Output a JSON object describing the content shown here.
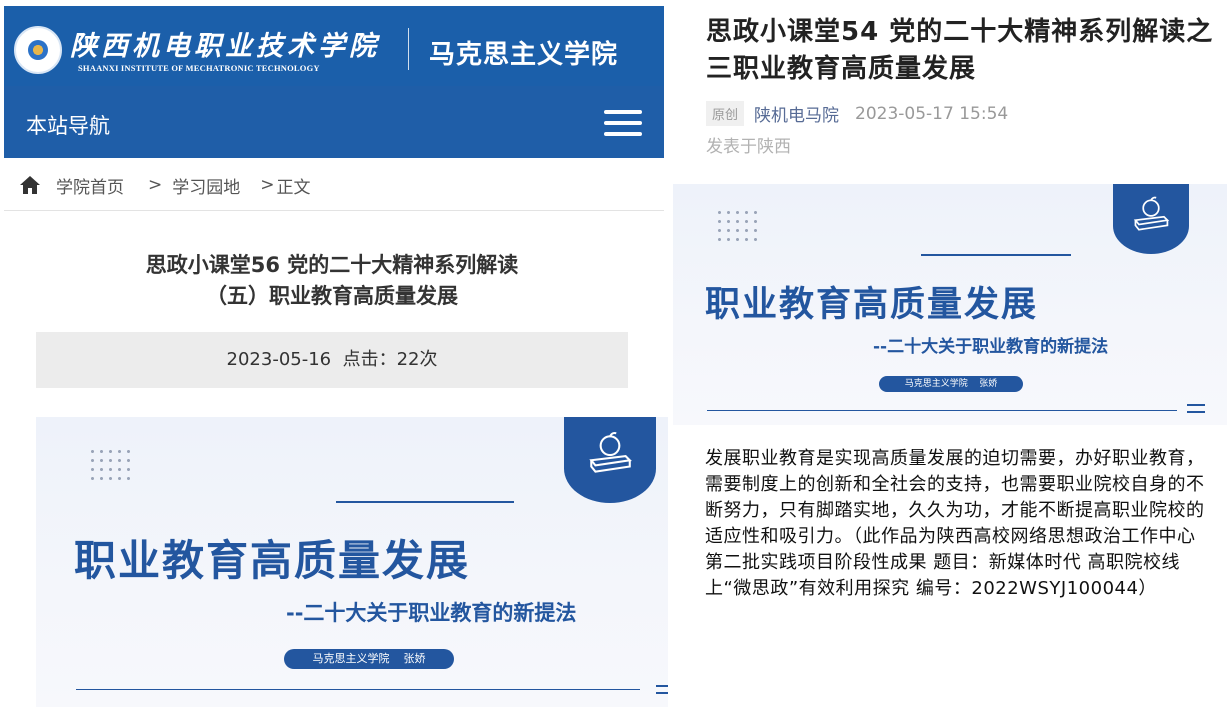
{
  "left": {
    "school_name_cn": "陕西机电职业技术学院",
    "school_name_en": "SHAANXI INSTITUTE OF MECHATRONIC TECHNOLOGY",
    "college_name": "马克思主义学院",
    "nav_label": "本站导航",
    "breadcrumb": {
      "home": "学院首页",
      "sep1": ">",
      "section": "学习园地",
      "sep2": ">",
      "current": "正文"
    },
    "article_title_line1": "思政小课堂56 党的二十大精神系列解读",
    "article_title_line2": "（五）职业教育高质量发展",
    "meta": "2023-05-16  点击：22次",
    "banner": {
      "headline": "职业教育高质量发展",
      "subheadline": "--二十大关于职业教育的新提法",
      "presenter": "马克思主义学院    张娇"
    }
  },
  "right": {
    "title": "思政小课堂54 党的二十大精神系列解读之三职业教育高质量发展",
    "tag": "原创",
    "author": "陕机电马院",
    "datetime": "2023-05-17 15:54",
    "location": "发表于陕西",
    "banner": {
      "headline": "职业教育高质量发展",
      "subheadline": "--二十大关于职业教育的新提法",
      "presenter": "马克思主义学院    张娇"
    },
    "body": "发展职业教育是实现高质量发展的迫切需要，办好职业教育，需要制度上的创新和全社会的支持，也需要职业院校自身的不断努力，只有脚踏实地，久久为功，才能不断提高职业院校的适应性和吸引力。（此作品为陕西高校网络思想政治工作中心第二批实践项目阶段性成果 题目：新媒体时代 高职院校线上“微思政”有效利用探究  编号：2022WSYJ100044）"
  },
  "colors": {
    "brand_blue": "#1b5faa",
    "banner_blue": "#23569f",
    "link_blue": "#576b95"
  }
}
